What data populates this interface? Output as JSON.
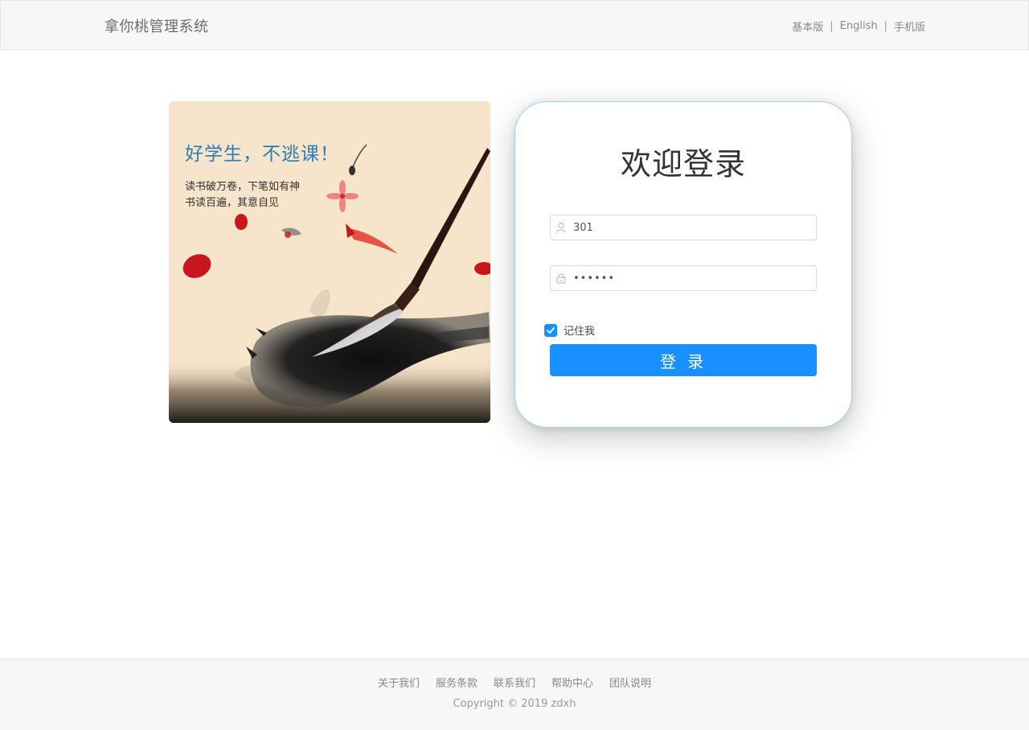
{
  "header": {
    "brand": "拿你桃管理系统",
    "links": [
      "基本版",
      "English",
      "手机版"
    ],
    "separator": "|"
  },
  "promo": {
    "title": "好学生，不逃课！",
    "lines": [
      "读书破万卷，下笔如有神",
      "书读百遍，其意自见"
    ]
  },
  "login": {
    "title": "欢迎登录",
    "username": "301",
    "password": "••••••",
    "remember_label": "记住我",
    "remember_checked": true,
    "submit_label": "登 录",
    "accent_color": "#1890ff"
  },
  "footer": {
    "links": [
      "关于我们",
      "服务条款",
      "联系我们",
      "帮助中心",
      "团队说明"
    ],
    "copyright": "Copyright © 2019 zdxh"
  },
  "icons": {
    "user_field": "user-icon",
    "password_field": "lock-icon",
    "checkbox": "check-icon"
  }
}
